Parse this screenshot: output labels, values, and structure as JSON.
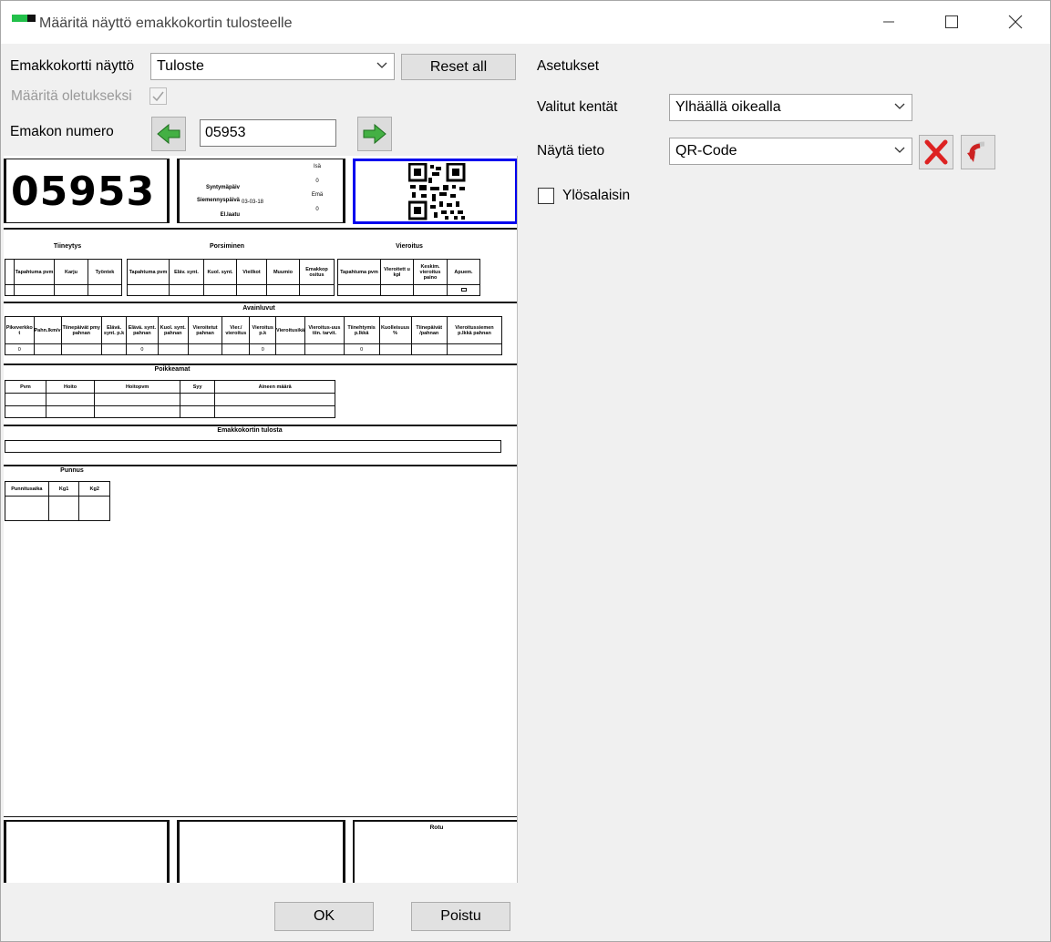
{
  "window": {
    "title": "Määritä näyttö emakkokortin tulosteelle"
  },
  "form": {
    "emakkokortti_label": "Emakkokortti näyttö",
    "emakkokortti_value": "Tuloste",
    "reset_all_label": "Reset all",
    "default_label": "Määritä oletukseksi",
    "emakon_numero_label": "Emakon numero",
    "emakon_numero_value": "05953"
  },
  "settings": {
    "title": "Asetukset",
    "selected_fields_label": "Valitut kentät",
    "selected_fields_value": "Ylhäällä oikealla",
    "show_info_label": "Näytä tieto",
    "show_info_value": "QR-Code",
    "upside_down_label": "Ylösalaisin"
  },
  "preview": {
    "sow_number": "05953",
    "info_labels": [
      "Syntymäpäiv",
      "Siemennyspäivä",
      "El.laatu"
    ],
    "info_date": "03-03-18",
    "side_labels": [
      "Isä",
      "0",
      "Emä",
      "0"
    ],
    "history_groups": [
      "Tiineytys",
      "Porsiminen",
      "Vieroitus"
    ],
    "history_headers": [
      "Tapahtuma pvm",
      "Karju",
      "Työntek",
      "Tapahtuma pvm",
      "Eläv. synt.",
      "Kuol. synt.",
      "Vieilkot",
      "Muumio",
      "Emakkop ositus",
      "Tapahtuma pvm",
      "Vieroitett u kpl",
      "Keskim. vieroitus paino",
      "Apuem."
    ],
    "key_figures_title": "Avainluvut",
    "key_headers": [
      "Pikeverkko t",
      "Pahn.lkm/v",
      "Tiinepäivät pmy pahnan",
      "Elävä. synt. p.k",
      "Elävä. synt. pahnan",
      "Kuol. synt. pahnan",
      "Vieroitetut pahnan",
      "Vier./ vieroitus",
      "Vieroitus p.k",
      "Vieroitusikä",
      "Vieroitus-uus tiin. tarvit.",
      "Tiinehtymis p.lkkä",
      "Kuolleisuus %",
      "Tiinepäivät /pahnan",
      "Vieroitussiemen p.lkkä pahnan"
    ],
    "key_values": [
      "0",
      "0",
      "0",
      "0",
      "0"
    ],
    "treatments_title": "Poikkeamat",
    "treatment_headers": [
      "Pvm",
      "Hoito",
      "Hoitopvm",
      "Syy",
      "Aineen määrä"
    ],
    "notes_title": "Emakkokortin tulosta",
    "weights_title": "Punnus",
    "weight_headers": [
      "Punnitusaika",
      "Kg1",
      "Kg2"
    ],
    "bottom_title": "Rotu"
  },
  "footer": {
    "ok_label": "OK",
    "cancel_label": "Poistu"
  },
  "colors": {
    "accent_blue": "#0000ee",
    "arrow_green": "#44b044",
    "delete_red": "#dd2222"
  },
  "icons": {
    "prev": "arrow-left-icon",
    "next": "arrow-right-icon",
    "delete": "delete-x-icon",
    "undo": "undo-icon"
  }
}
